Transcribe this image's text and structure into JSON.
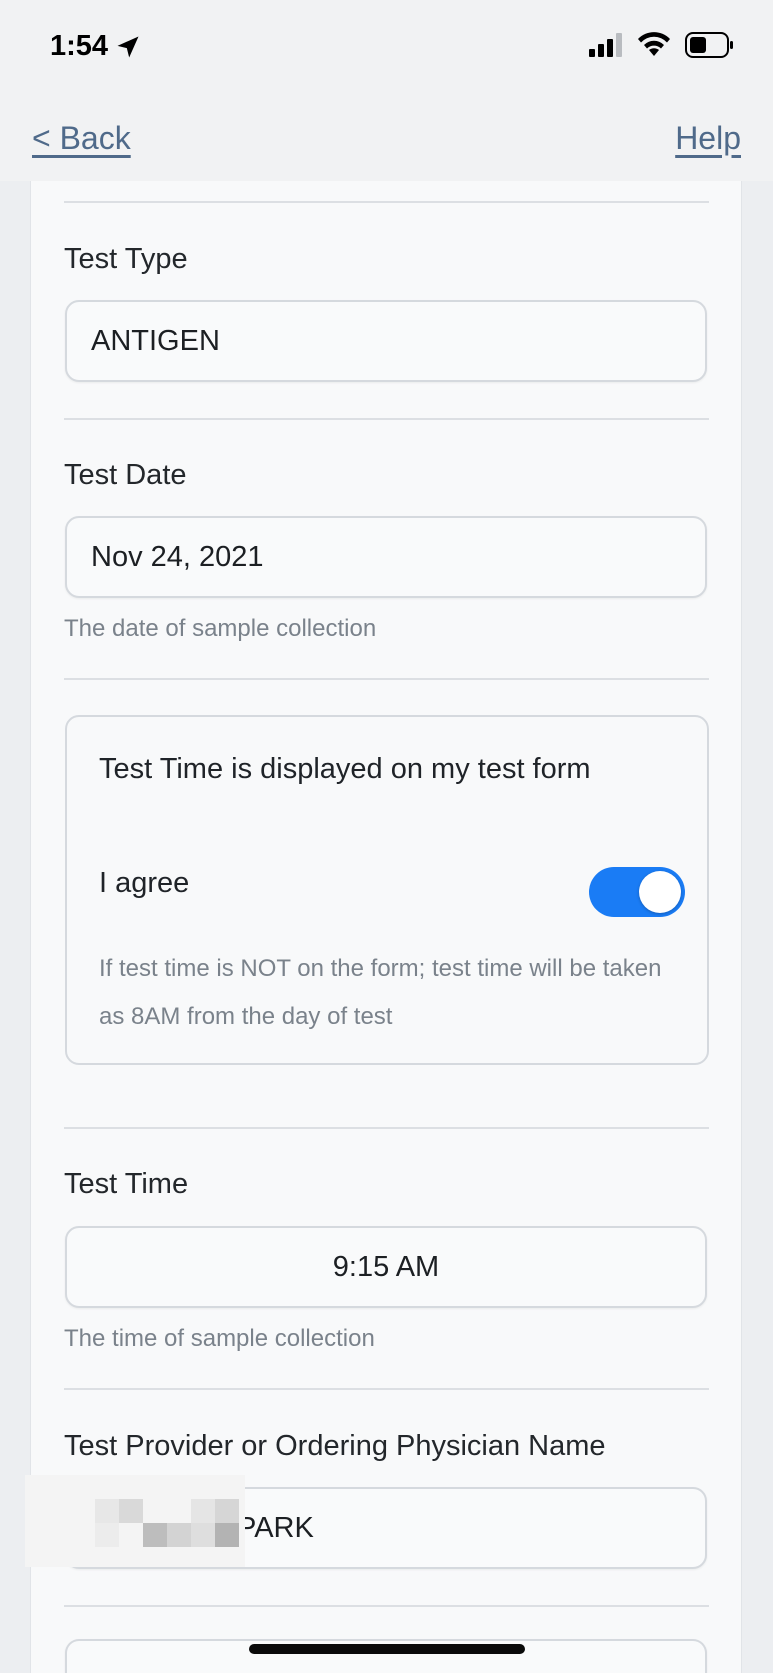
{
  "status_bar": {
    "time": "1:54",
    "icons": [
      "location-arrow-icon",
      "cellular-signal-icon",
      "wifi-icon",
      "battery-icon"
    ]
  },
  "nav": {
    "back_label": "< Back",
    "help_label": "Help"
  },
  "form": {
    "test_type": {
      "label": "Test Type",
      "value": "ANTIGEN"
    },
    "test_date": {
      "label": "Test Date",
      "value": "Nov 24, 2021",
      "hint": "The date of sample collection"
    },
    "consent": {
      "title": "Test Time is displayed on my test form",
      "agree_label": "I agree",
      "agree_on": true,
      "note": "If test time is NOT on the form; test time will be taken as 8AM from the day of test"
    },
    "test_time": {
      "label": "Test Time",
      "value": "9:15 AM",
      "hint": "The time of sample collection"
    },
    "provider": {
      "label": "Test Provider or Ordering Physician Name",
      "value_visible": "PARK"
    }
  },
  "colors": {
    "link": "#4f6a8a",
    "toggle_on": "#1a7cf5"
  }
}
